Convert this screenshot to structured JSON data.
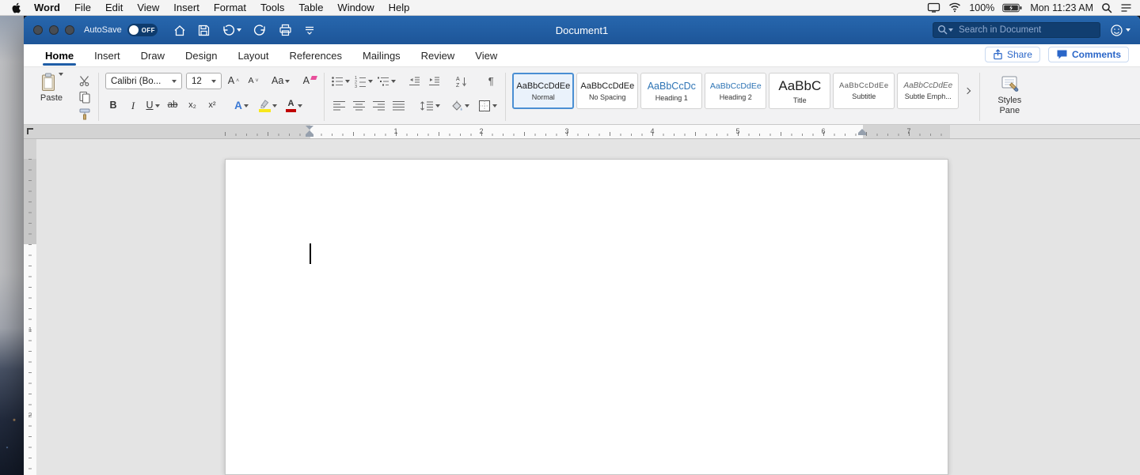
{
  "menu_bar": {
    "items": [
      "Word",
      "File",
      "Edit",
      "View",
      "Insert",
      "Format",
      "Tools",
      "Table",
      "Window",
      "Help"
    ],
    "battery_percent": "100%",
    "clock": "Mon 11:23 AM"
  },
  "title_bar": {
    "autosave_label": "AutoSave",
    "autosave_state": "OFF",
    "document_title": "Document1",
    "search_placeholder": "Search in Document"
  },
  "tabs": {
    "items": [
      "Home",
      "Insert",
      "Draw",
      "Design",
      "Layout",
      "References",
      "Mailings",
      "Review",
      "View"
    ],
    "share_label": "Share",
    "comments_label": "Comments"
  },
  "ribbon": {
    "paste_label": "Paste",
    "font_name": "Calibri (Bo...",
    "font_size": "12",
    "grow_font": "A",
    "shrink_font": "A",
    "change_case": "Aa",
    "clear_format": "A",
    "bold": "B",
    "italic": "I",
    "underline": "U",
    "strikethrough": "ab",
    "subscript": "x₂",
    "superscript": "x²",
    "text_effects": "A",
    "font_color": "A",
    "sort_a": "A",
    "sort_z": "Z",
    "pilcrow": "¶",
    "styles": [
      {
        "sample": "AaBbCcDdEe",
        "label": "Normal"
      },
      {
        "sample": "AaBbCcDdEe",
        "label": "No Spacing"
      },
      {
        "sample": "AaBbCcDc",
        "label": "Heading 1"
      },
      {
        "sample": "AaBbCcDdEe",
        "label": "Heading 2"
      },
      {
        "sample": "AaBbC",
        "label": "Title"
      },
      {
        "sample": "AaBbCcDdEe",
        "label": "Subtitle"
      },
      {
        "sample": "AaBbCcDdEe",
        "label": "Subtle Emph..."
      }
    ],
    "styles_pane_line1": "Styles",
    "styles_pane_line2": "Pane"
  },
  "ruler": {
    "h_numbers": [
      "1",
      "2",
      "3",
      "4",
      "5",
      "6",
      "7"
    ],
    "v_numbers": [
      "1",
      "2"
    ]
  },
  "colors": {
    "titlebar_blue": "#1e5a9e",
    "accent_blue": "#2b579a",
    "heading_blue": "#2e74b5",
    "highlight_yellow": "#f8e71c",
    "font_color_red": "#c00000"
  }
}
